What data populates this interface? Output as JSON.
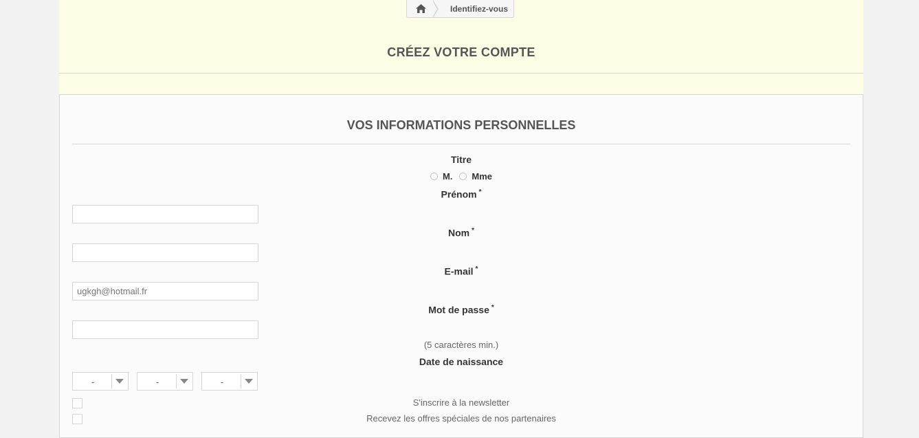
{
  "breadcrumb": {
    "home_icon": "home-icon",
    "current": "Identifiez-vous"
  },
  "page_heading": "CRÉEZ VOTRE COMPTE",
  "form": {
    "section_title": "VOS INFORMATIONS PERSONNELLES",
    "title_label": "Titre",
    "title_options": [
      "M.",
      "Mme"
    ],
    "required_mark": "*",
    "firstname_label": "Prénom",
    "firstname_value": "",
    "lastname_label": "Nom",
    "lastname_value": "",
    "email_label": "E-mail",
    "email_value": "ugkgh@hotmail.fr",
    "password_label": "Mot de passe",
    "password_value": "",
    "password_hint": "(5 caractères min.)",
    "birthdate_label": "Date de naissance",
    "birth_day": "-",
    "birth_month": "-",
    "birth_year": "-",
    "newsletter_label": "S'inscrire à la newsletter",
    "optin_label": "Recevez les offres spéciales de nos partenaires"
  }
}
